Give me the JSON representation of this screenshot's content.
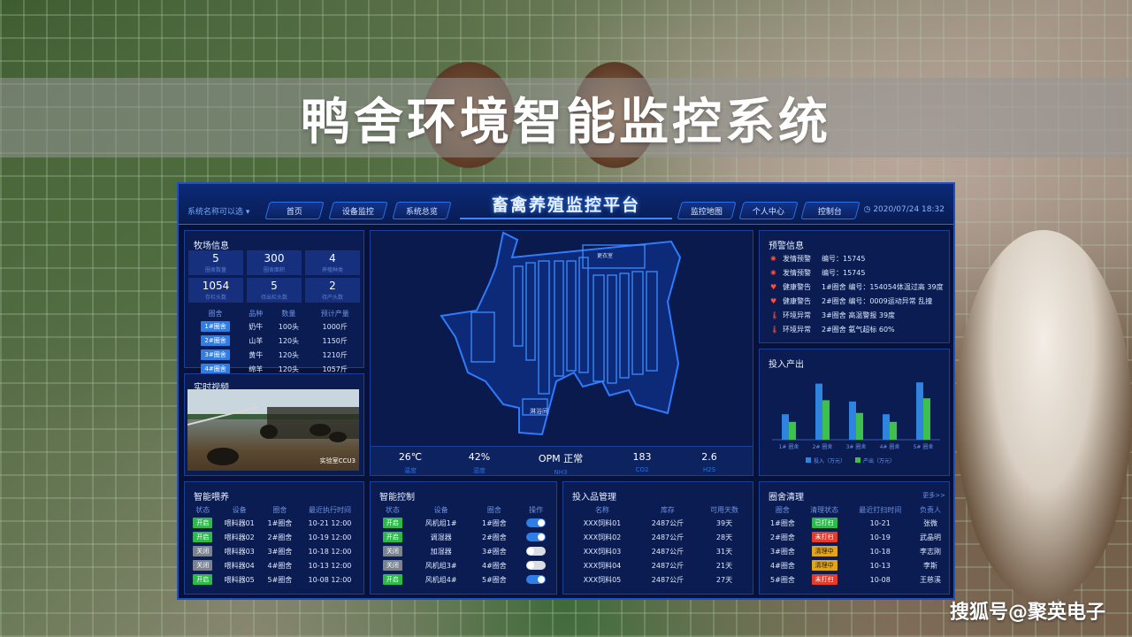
{
  "headline": "鸭舍环境智能监控系统",
  "watermark": "搜狐号@聚英电子",
  "dashboard": {
    "title": "畜禽养殖监控平台",
    "system_select": "系统名称可以选 ▾",
    "datetime": "2020/07/24  18:32",
    "nav_left": [
      "首页",
      "设备监控",
      "系统总览"
    ],
    "nav_right": [
      "监控地图",
      "个人中心",
      "控制台"
    ],
    "farm_info": {
      "title": "牧场信息",
      "stats": [
        {
          "value": "5",
          "label": "圈舍数量"
        },
        {
          "value": "300",
          "label": "圈舍面积"
        },
        {
          "value": "4",
          "label": "养殖种类"
        },
        {
          "value": "1054",
          "label": "存栏头数"
        },
        {
          "value": "5",
          "label": "待出栏头数"
        },
        {
          "value": "2",
          "label": "待产头数"
        }
      ],
      "columns": [
        "圈舍",
        "品种",
        "数量",
        "预计产量"
      ],
      "rows": [
        [
          "1#圈舍",
          "奶牛",
          "100头",
          "1000斤"
        ],
        [
          "2#圈舍",
          "山羊",
          "120头",
          "1150斤"
        ],
        [
          "3#圈舍",
          "黄牛",
          "120头",
          "1210斤"
        ],
        [
          "4#圈舍",
          "绵羊",
          "120头",
          "1057斤"
        ]
      ]
    },
    "video": {
      "title": "实时视频",
      "caption": "实验室CCU3"
    },
    "environment": [
      {
        "value": "26℃",
        "label": "温度"
      },
      {
        "value": "42%",
        "label": "湿度"
      },
      {
        "value": "OPM 正常",
        "label": "NH3"
      },
      {
        "value": "183",
        "label": "CO2"
      },
      {
        "value": "2.6",
        "label": "H2S"
      }
    ],
    "alerts": {
      "title": "预警信息",
      "items": [
        {
          "icon": "alarm-icon",
          "type": "发情预警",
          "text": "编号：15745"
        },
        {
          "icon": "alarm-icon",
          "type": "发情预警",
          "text": "编号：15745"
        },
        {
          "icon": "heart-icon",
          "type": "健康警告",
          "text": "1#圈舍    编号：154054体温过高    39度"
        },
        {
          "icon": "heart-icon",
          "type": "健康警告",
          "text": "2#圈舍    编号：0009运动异常    乱撞"
        },
        {
          "icon": "thermometer-icon",
          "type": "环境异常",
          "text": "3#圈舍    高温警报    39度"
        },
        {
          "icon": "thermometer-icon",
          "type": "环境异常",
          "text": "2#圈舍    氨气超标    60%"
        }
      ]
    },
    "chart_data": {
      "type": "bar",
      "title": "投入产出",
      "categories": [
        "1# 圈舍",
        "2# 圈舍",
        "3# 圈舍",
        "4# 圈舍",
        "5# 圈舍"
      ],
      "series": [
        {
          "name": "投入（万元）",
          "color": "#2f84e0",
          "values": [
            40,
            88,
            60,
            40,
            90
          ]
        },
        {
          "name": "产出（万元）",
          "color": "#3ec04e",
          "values": [
            28,
            62,
            42,
            28,
            65
          ]
        }
      ],
      "ylim": [
        0,
        100
      ]
    },
    "feeding": {
      "title": "智能喂养",
      "columns": [
        "状态",
        "设备",
        "圈舍",
        "最近执行时间"
      ],
      "rows": [
        {
          "status": "开启",
          "tag": "green",
          "device": "喂料器01",
          "pen": "1#圈舍",
          "time": "10-21  12:00"
        },
        {
          "status": "开启",
          "tag": "green",
          "device": "喂料器02",
          "pen": "2#圈舍",
          "time": "10-19  12:00"
        },
        {
          "status": "关闭",
          "tag": "gray",
          "device": "喂料器03",
          "pen": "3#圈舍",
          "time": "10-18  12:00"
        },
        {
          "status": "关闭",
          "tag": "gray",
          "device": "喂料器04",
          "pen": "4#圈舍",
          "time": "10-13  12:00"
        },
        {
          "status": "开启",
          "tag": "green",
          "device": "喂料器05",
          "pen": "5#圈舍",
          "time": "10-08  12:00"
        }
      ]
    },
    "control": {
      "title": "智能控制",
      "columns": [
        "状态",
        "设备",
        "圈舍",
        "操作"
      ],
      "rows": [
        {
          "status": "开启",
          "tag": "green",
          "device": "风机组1#",
          "pen": "1#圈舍",
          "on": true
        },
        {
          "status": "开启",
          "tag": "green",
          "device": "调湿器",
          "pen": "2#圈舍",
          "on": true
        },
        {
          "status": "关闭",
          "tag": "gray",
          "device": "加湿器",
          "pen": "3#圈舍",
          "on": false
        },
        {
          "status": "关闭",
          "tag": "gray",
          "device": "风机组3#",
          "pen": "4#圈舍",
          "on": false
        },
        {
          "status": "开启",
          "tag": "green",
          "device": "风机组4#",
          "pen": "5#圈舍",
          "on": true
        }
      ]
    },
    "inputs": {
      "title": "投入品管理",
      "columns": [
        "名称",
        "库存",
        "可用天数"
      ],
      "rows": [
        [
          "XXX饲料01",
          "2487公斤",
          "39天"
        ],
        [
          "XXX饲料02",
          "2487公斤",
          "28天"
        ],
        [
          "XXX饲料03",
          "2487公斤",
          "31天"
        ],
        [
          "XXX饲料04",
          "2487公斤",
          "21天"
        ],
        [
          "XXX饲料05",
          "2487公斤",
          "27天"
        ]
      ]
    },
    "cleaning": {
      "title": "圈舍清理",
      "more": "更多>>",
      "columns": [
        "圈舍",
        "清理状态",
        "最近打扫时间",
        "负责人"
      ],
      "rows": [
        {
          "pen": "1#圈舍",
          "status": "已打扫",
          "tag": "green",
          "time": "10-21",
          "owner": "张微"
        },
        {
          "pen": "2#圈舍",
          "status": "未打扫",
          "tag": "red",
          "time": "10-19",
          "owner": "武晶明"
        },
        {
          "pen": "3#圈舍",
          "status": "清理中",
          "tag": "yellow",
          "time": "10-18",
          "owner": "李志刚"
        },
        {
          "pen": "4#圈舍",
          "status": "清理中",
          "tag": "yellow",
          "time": "10-13",
          "owner": "李斯"
        },
        {
          "pen": "5#圈舍",
          "status": "未打扫",
          "tag": "red",
          "time": "10-08",
          "owner": "王慈溪"
        }
      ]
    },
    "map_labels": [
      "淋浴间",
      "更衣室"
    ]
  }
}
